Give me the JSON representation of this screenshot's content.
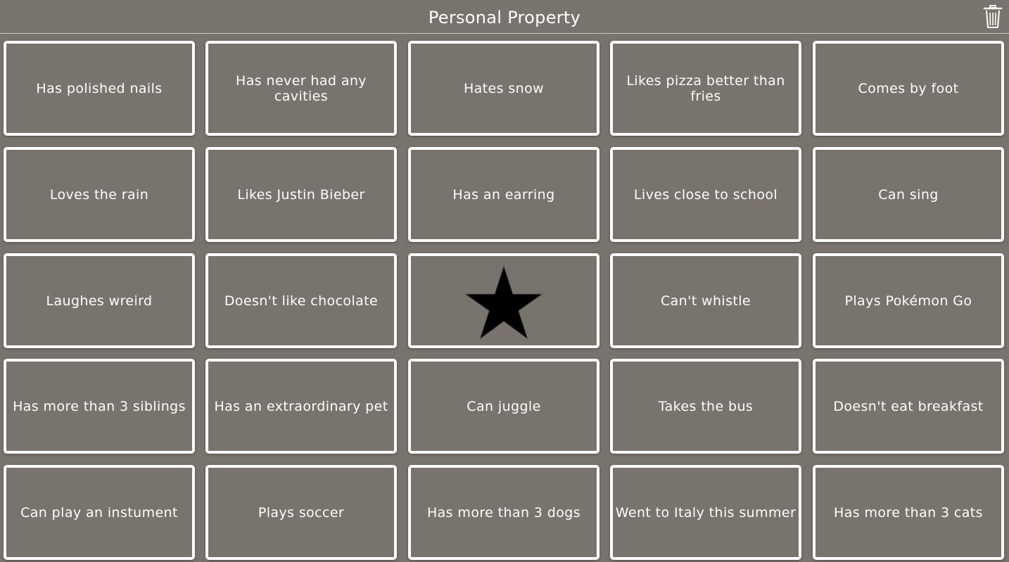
{
  "header": {
    "title": "Personal Property",
    "trash_icon": "trash-icon"
  },
  "board": {
    "free_icon": "star-icon",
    "rows": [
      [
        "Has polished nails",
        "Has never had any cavities",
        "Hates snow",
        "Likes pizza better than fries",
        "Comes by foot"
      ],
      [
        "Loves the rain",
        "Likes Justin Bieber",
        "Has an earring",
        "Lives close to school",
        "Can sing"
      ],
      [
        "Laughes wreird",
        "Doesn't like chocolate",
        "",
        "Can't whistle",
        "Plays Pokémon Go"
      ],
      [
        "Has more than 3 siblings",
        "Has an extraordinary pet",
        "Can juggle",
        "Takes the bus",
        "Doesn't eat breakfast"
      ],
      [
        "Can play an instument",
        "Plays soccer",
        "Has more than 3 dogs",
        "Went to Italy this summer",
        "Has more than 3 cats"
      ]
    ]
  },
  "colors": {
    "background": "#79736d",
    "border": "#ffffff",
    "text": "#ffffff",
    "star": "#000000"
  }
}
